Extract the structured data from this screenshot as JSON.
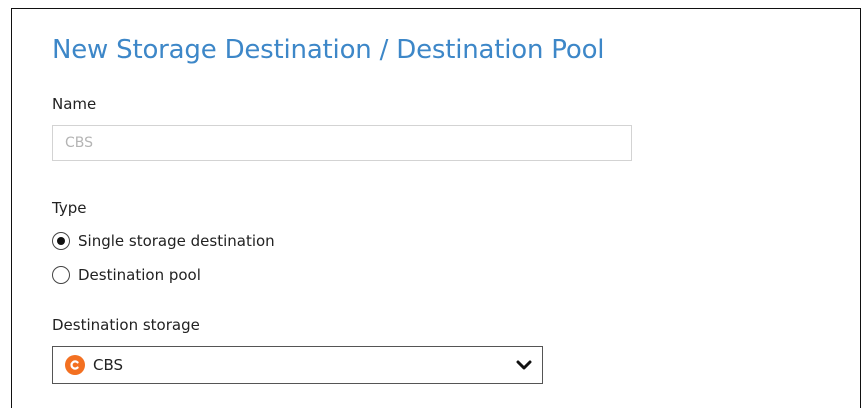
{
  "dialog": {
    "title": "New Storage Destination / Destination Pool",
    "name_label": "Name",
    "name_value": "CBS",
    "type_label": "Type",
    "type_options": [
      {
        "label": "Single storage destination",
        "selected": true
      },
      {
        "label": "Destination pool",
        "selected": false
      }
    ],
    "destination_label": "Destination storage",
    "destination_value": "CBS",
    "destination_icon": "cbs-logo-icon"
  },
  "colors": {
    "title": "#3d87c8",
    "cbs_icon": "#f37021",
    "input_border": "#d3d3d3",
    "disabled_text": "#b4b4b4"
  }
}
